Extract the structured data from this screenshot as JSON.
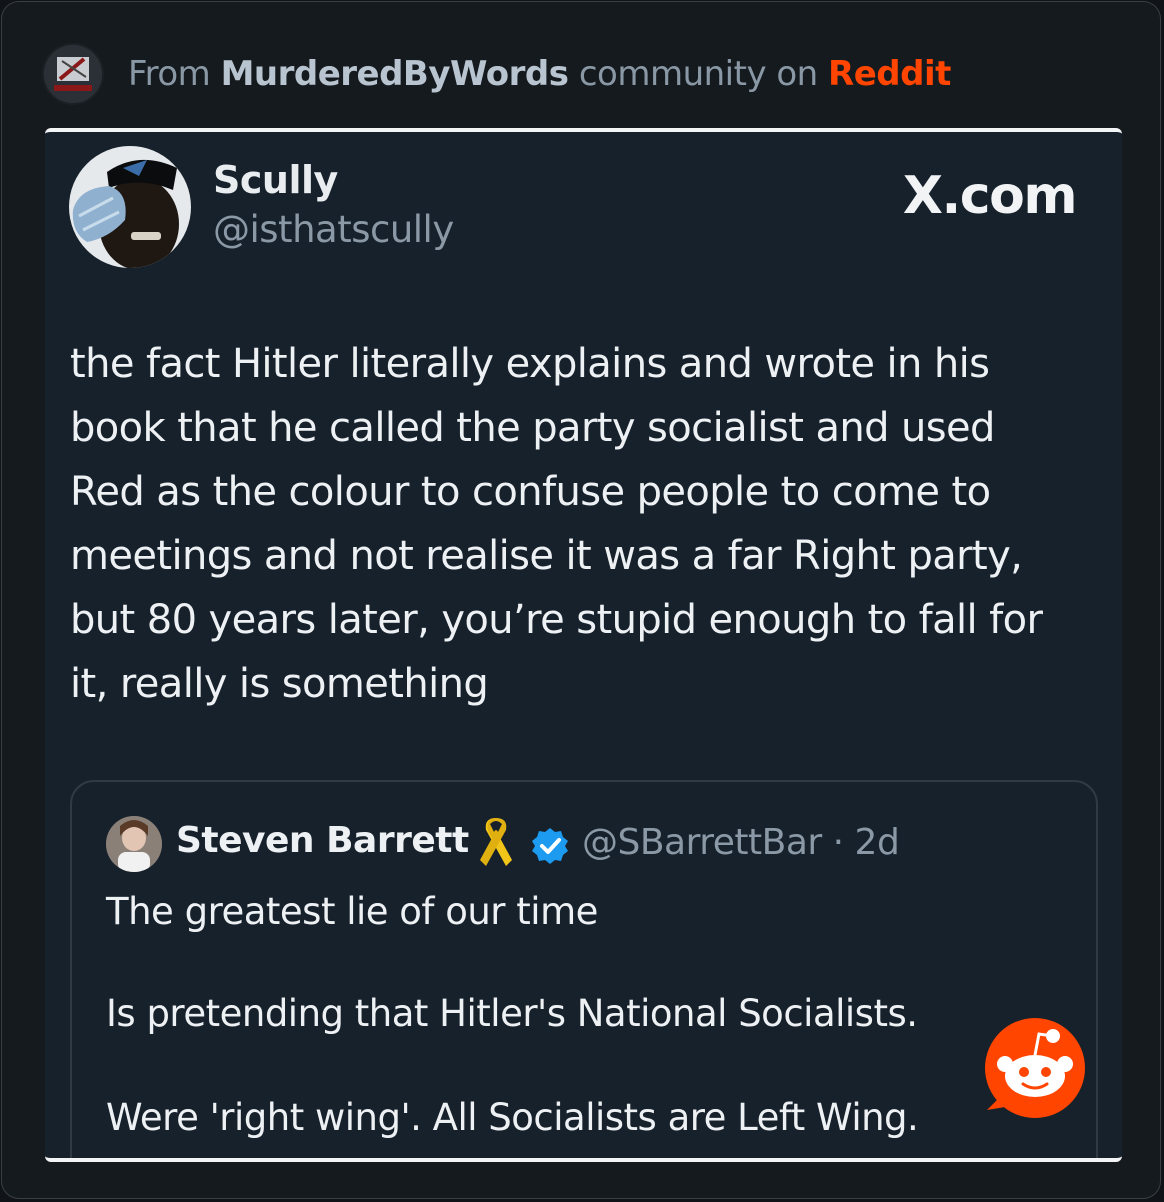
{
  "header": {
    "prefix": "From",
    "subreddit": "MurderedByWords",
    "middle": "community on",
    "platform": "Reddit",
    "subreddit_logo_text": "MURDERED BY WORDS"
  },
  "tweet": {
    "author_name": "Scully",
    "author_handle": "@isthatscully",
    "source": "X.com",
    "text": "the fact Hitler literally explains and wrote in his\nbook that he called the party socialist and used\nRed as the colour to confuse people to come to\nmeetings and not realise it was a far Right party,\nbut 80 years later, you’re stupid enough to fall for\nit, really is something"
  },
  "quoted_tweet": {
    "author_name": "Steven Barrett",
    "handle_time": "@SBarrettBar · 2d",
    "lines": [
      "The greatest lie of our time",
      "Is pretending that Hitler's National Socialists.",
      "Were 'right wing'. All Socialists are Left Wing."
    ]
  },
  "icons": {
    "subreddit_logo": "murderedbywords-logo",
    "ribbon": "yellow-ribbon-icon",
    "verified": "verified-badge-icon",
    "reddit": "reddit-snoo-icon"
  },
  "colors": {
    "reddit_orange": "#ff4500",
    "verified_blue": "#1d9bf0",
    "card_bg": "#16212b",
    "ribbon_yellow": "#f2c618"
  }
}
